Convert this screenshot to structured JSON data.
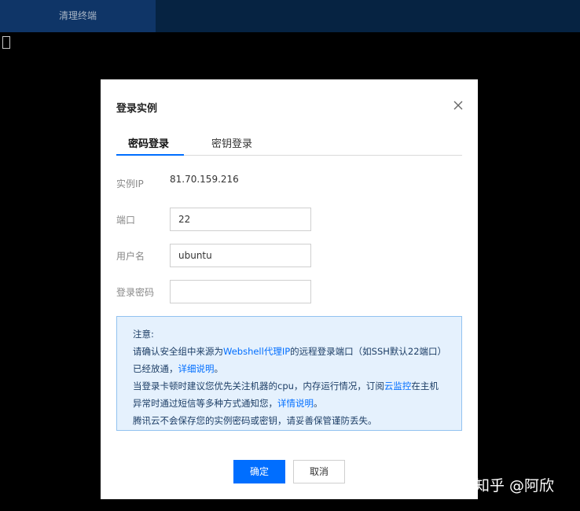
{
  "topbar": {
    "tab_label": "清理终端"
  },
  "modal": {
    "title": "登录实例",
    "tabs": [
      {
        "label": "密码登录",
        "active": true
      },
      {
        "label": "密钥登录",
        "active": false
      }
    ],
    "instance_ip": {
      "label": "实例IP",
      "value": "81.70.159.216"
    },
    "port": {
      "label": "端口",
      "value": "22"
    },
    "username": {
      "label": "用户名",
      "value": "ubuntu"
    },
    "password": {
      "label": "登录密码",
      "value": ""
    },
    "notice": {
      "heading": "注意:",
      "line1_a": "请确认安全组中来源为",
      "line1_link": "Webshell代理IP",
      "line1_b": "的远程登录端口（如SSH默认22端口）已经放通，",
      "line1_link2": "详细说明",
      "line1_c": "。",
      "line2_a": "当登录卡顿时建议您优先关注机器的cpu，内存运行情况，订阅",
      "line2_link": "云监控",
      "line2_b": "在主机异常时通过短信等多种方式通知您，",
      "line2_link2": "详情说明",
      "line2_c": "。",
      "line3": "腾讯云不会保存您的实例密码或密钥，请妥善保管谨防丢失。"
    },
    "ok_label": "确定",
    "cancel_label": "取消"
  },
  "watermark": "知乎 @阿欣",
  "colors": {
    "accent": "#006eff",
    "notice_bg": "#e5f1fd",
    "topbar": "#062342"
  }
}
